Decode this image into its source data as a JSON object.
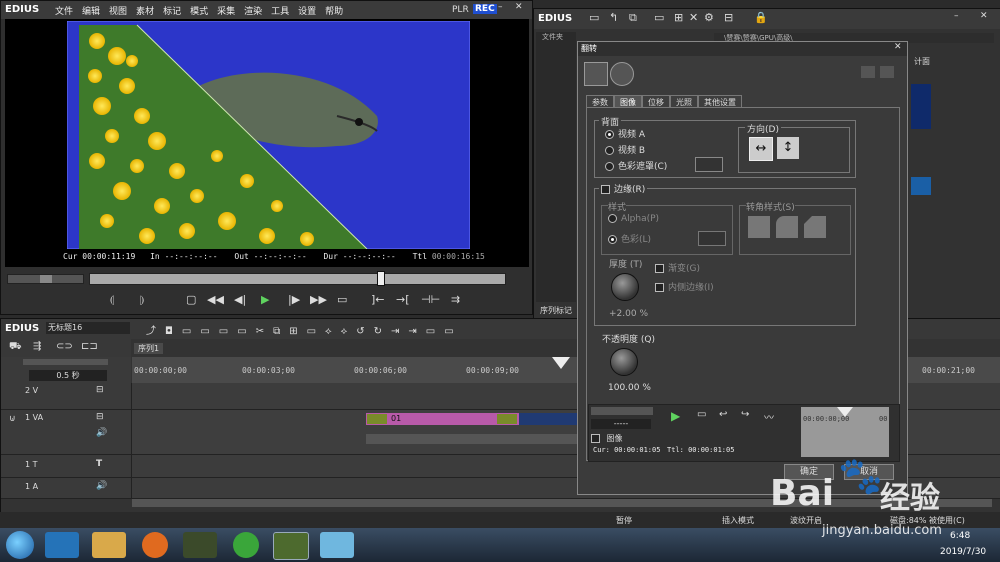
{
  "player": {
    "app_name": "EDIUS",
    "menu": [
      "文件",
      "编辑",
      "视图",
      "素材",
      "标记",
      "模式",
      "采集",
      "渲染",
      "工具",
      "设置",
      "帮助"
    ],
    "plr": "PLR",
    "rec": "REC",
    "cur_label": "Cur",
    "cur": "00:00:11:19",
    "in_label": "In",
    "in": "--:--:--:--",
    "out_label": "Out",
    "out": "--:--:--:--",
    "dur_label": "Dur",
    "dur": "--:--:--:--",
    "ttl_label": "Ttl",
    "ttl": "00:00:16:15"
  },
  "bin": {
    "app_name": "EDIUS",
    "folder_header": "文件夹",
    "path": "\\赞赛\\赞赛\\GPU\\高级\\",
    "seq_mark": "序列标记",
    "side_text": "计面"
  },
  "dialog": {
    "title": "翻转",
    "tabs": [
      "参数",
      "图像",
      "位移",
      "光照",
      "其他设置"
    ],
    "active_tab": 1,
    "background_group": "背面",
    "radio_video_a": "视频 A",
    "radio_video_b": "视频 B",
    "radio_color_matte": "色彩遮罩(C)",
    "direction_group": "方向(D)",
    "border_check": "边缘(R)",
    "style_group": "样式",
    "style_alpha": "Alpha(P)",
    "style_color": "色彩(L)",
    "corner_group": "转角样式(S)",
    "thickness_label": "厚度 (T)",
    "thickness_value": "+2.00 %",
    "gradient": "渐变(G)",
    "inner_edge": "内侧边缘(I)",
    "opacity_label": "不透明度 (Q)",
    "opacity_value": "100.00 %",
    "transport_value": "-----",
    "track_name": "图像",
    "cur_info": "Cur: 00:00:01:05",
    "ttl_info": "Ttl: 00:00:01:05",
    "mini_tc": "00:00:00;00",
    "mini_tc2": "00:",
    "ok": "确定",
    "cancel": "取消"
  },
  "timeline": {
    "app_name": "EDIUS",
    "project": "无标题16",
    "seq_tab": "序列1",
    "zoom": "0.5 秒",
    "ruler": [
      "00:00:00;00",
      "00:00:03;00",
      "00:00:06;00",
      "00:00:09;00",
      "00:00:21;00"
    ],
    "tracks": [
      {
        "name": "2 V"
      },
      {
        "name": "1 VA"
      },
      {
        "name": "1 T"
      },
      {
        "name": "1 A"
      }
    ],
    "clip_label": "01"
  },
  "status": {
    "pause": "暂停",
    "insert_mode": "插入模式",
    "ripple": "波纹开启",
    "disk": "磁盘:84% 被使用(C)"
  },
  "taskbar": {
    "time": "6:48",
    "date": "2019/7/30"
  },
  "watermark": {
    "brand": "Bai",
    "brand2": "经验",
    "url": "jingyan.baidu.com"
  },
  "colors": {
    "clip": "#b85aa9",
    "accent_play": "#5fd35f",
    "preview_bg": "#2c36c9",
    "rec": "#1f4fd1"
  }
}
